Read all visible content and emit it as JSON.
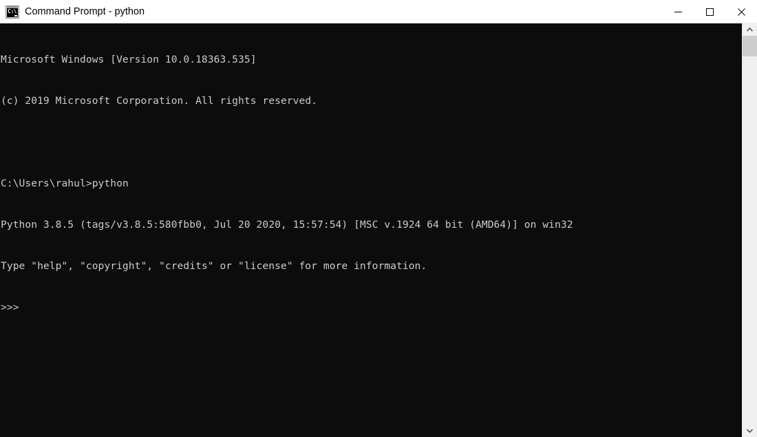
{
  "window": {
    "title": "Command Prompt - python",
    "icon": "command-prompt-icon",
    "icon_label": "C:\\",
    "background_color": "#0c0c0c",
    "titlebar_color": "#ffffff",
    "text_color": "#cccccc"
  },
  "window_controls": {
    "minimize_label": "Minimize",
    "maximize_label": "Maximize",
    "close_label": "Close"
  },
  "terminal": {
    "lines": [
      "Microsoft Windows [Version 10.0.18363.535]",
      "(c) 2019 Microsoft Corporation. All rights reserved.",
      "",
      "C:\\Users\\rahul>python",
      "Python 3.8.5 (tags/v3.8.5:580fbb0, Jul 20 2020, 15:57:54) [MSC v.1924 64 bit (AMD64)] on win32",
      "Type \"help\", \"copyright\", \"credits\" or \"license\" for more information.",
      ">>>"
    ],
    "os_banner": "Microsoft Windows [Version 10.0.18363.535]",
    "copyright": "(c) 2019 Microsoft Corporation. All rights reserved.",
    "command_prompt_path": "C:\\Users\\rahul>",
    "command_entered": "python",
    "python_version_line": "Python 3.8.5 (tags/v3.8.5:580fbb0, Jul 20 2020, 15:57:54) [MSC v.1924 64 bit (AMD64)] on win32",
    "python_help_line": "Type \"help\", \"copyright\", \"credits\" or \"license\" for more information.",
    "python_prompt": ">>>"
  },
  "scrollbar": {
    "up_arrow": "scroll-up-arrow",
    "down_arrow": "scroll-down-arrow",
    "thumb_position_percent": 0
  }
}
